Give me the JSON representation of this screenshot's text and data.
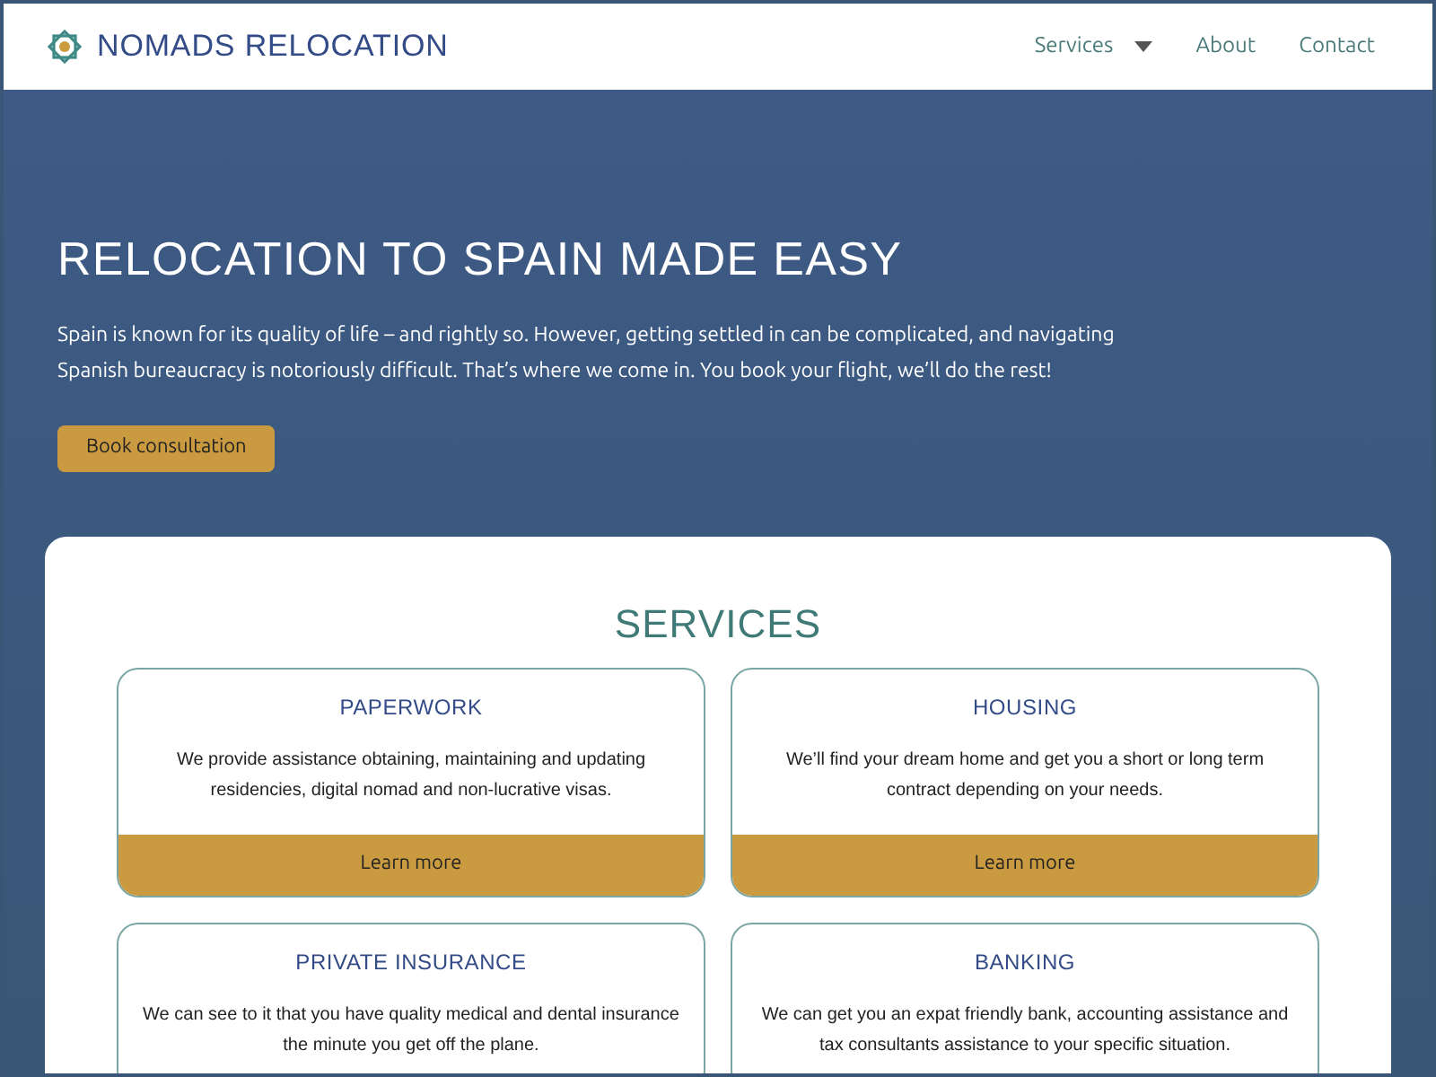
{
  "header": {
    "brand": "NOMADS RELOCATION",
    "nav": [
      {
        "label": "Services",
        "kind": "dropdown"
      },
      {
        "label": "About",
        "kind": "link"
      },
      {
        "label": "Contact",
        "kind": "link"
      }
    ]
  },
  "hero": {
    "title": "RELOCATION TO SPAIN MADE EASY",
    "text": "Spain is known for its quality of life – and rightly so. However, getting settled in can be complicated, and navigating Spanish bureaucracy is notoriously difficult. That’s where we come in. You book your flight, we’ll do the rest!",
    "button": "Book consultation"
  },
  "services": {
    "title": "SERVICES",
    "cards": [
      {
        "title": "PAPERWORK",
        "text": "We provide assistance obtaining, maintaining and updating residencies, digital nomad and non-lucrative visas.",
        "button": "Learn more"
      },
      {
        "title": "HOUSING",
        "text": "We’ll find your dream home and get you a short or long term contract depending on your needs.",
        "button": "Learn more"
      },
      {
        "title": "PRIVATE INSURANCE",
        "text": "We can see to it that you have quality medical and dental insurance the minute you get off the plane."
      },
      {
        "title": "BANKING",
        "text": "We can get you an expat friendly bank, accounting assistance and tax consultants assistance to your specific situation."
      }
    ]
  }
}
